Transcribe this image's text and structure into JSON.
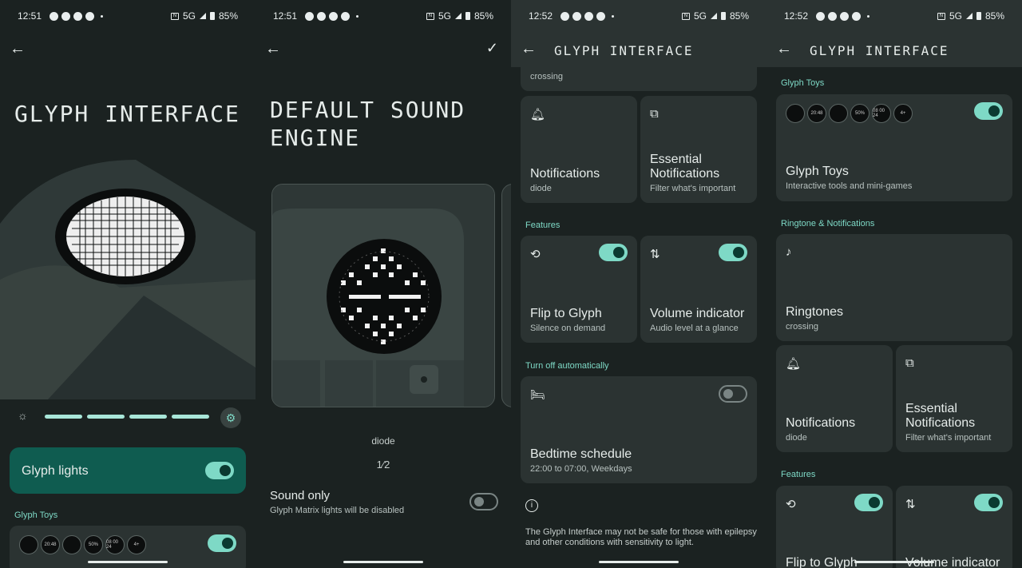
{
  "status": [
    {
      "time": "12:51",
      "network": "5G",
      "battery": "85%"
    },
    {
      "time": "12:51",
      "network": "5G",
      "battery": "85%"
    },
    {
      "time": "12:52",
      "network": "5G",
      "battery": "85%"
    },
    {
      "time": "12:52",
      "network": "5G",
      "battery": "85%"
    }
  ],
  "p1": {
    "title": "GLYPH INTERFACE",
    "brightness_segments": 4,
    "glyph_lights_label": "Glyph lights",
    "glyph_lights_on": true,
    "glyph_toys_section": "Glyph Toys",
    "toy_icons": [
      "",
      "20:48",
      "",
      "50%",
      "08 00 24",
      "4+"
    ]
  },
  "p2": {
    "title_line1": "DEFAULT SOUND",
    "title_line2": "ENGINE",
    "sound_name": "diode",
    "pager": "1⁄2",
    "sound_only_label": "Sound only",
    "sound_only_desc": "Glyph Matrix lights will be disabled",
    "sound_only_on": false
  },
  "p3": {
    "header": "GLYPH INTERFACE",
    "partial_sub": "crossing",
    "notifications": {
      "title": "Notifications",
      "sub": "diode"
    },
    "essential": {
      "title": "Essential Notifications",
      "sub": "Filter what's important"
    },
    "features_section": "Features",
    "flip": {
      "title": "Flip to Glyph",
      "sub": "Silence on demand",
      "on": true
    },
    "volume": {
      "title": "Volume indicator",
      "sub": "Audio level at a glance",
      "on": true
    },
    "turnoff_section": "Turn off automatically",
    "bedtime": {
      "title": "Bedtime schedule",
      "sub": "22:00 to 07:00, Weekdays",
      "on": false
    },
    "warning": "The Glyph Interface may not be safe for those with epilepsy and other conditions with sensitivity to light."
  },
  "p4": {
    "header": "GLYPH INTERFACE",
    "toys_section": "Glyph Toys",
    "toys": {
      "title": "Glyph Toys",
      "sub": "Interactive tools and mini-games",
      "on": true
    },
    "toy_icons": [
      "",
      "20:48",
      "",
      "50%",
      "08 00 24",
      "4+"
    ],
    "ring_section": "Ringtone & Notifications",
    "ringtones": {
      "title": "Ringtones",
      "sub": "crossing"
    },
    "notifications": {
      "title": "Notifications",
      "sub": "diode"
    },
    "essential": {
      "title": "Essential Notifications",
      "sub": "Filter what's important"
    },
    "features_section": "Features",
    "flip": {
      "title": "Flip to Glyph",
      "on": true
    },
    "volume": {
      "title": "Volume indicator",
      "on": true
    }
  }
}
